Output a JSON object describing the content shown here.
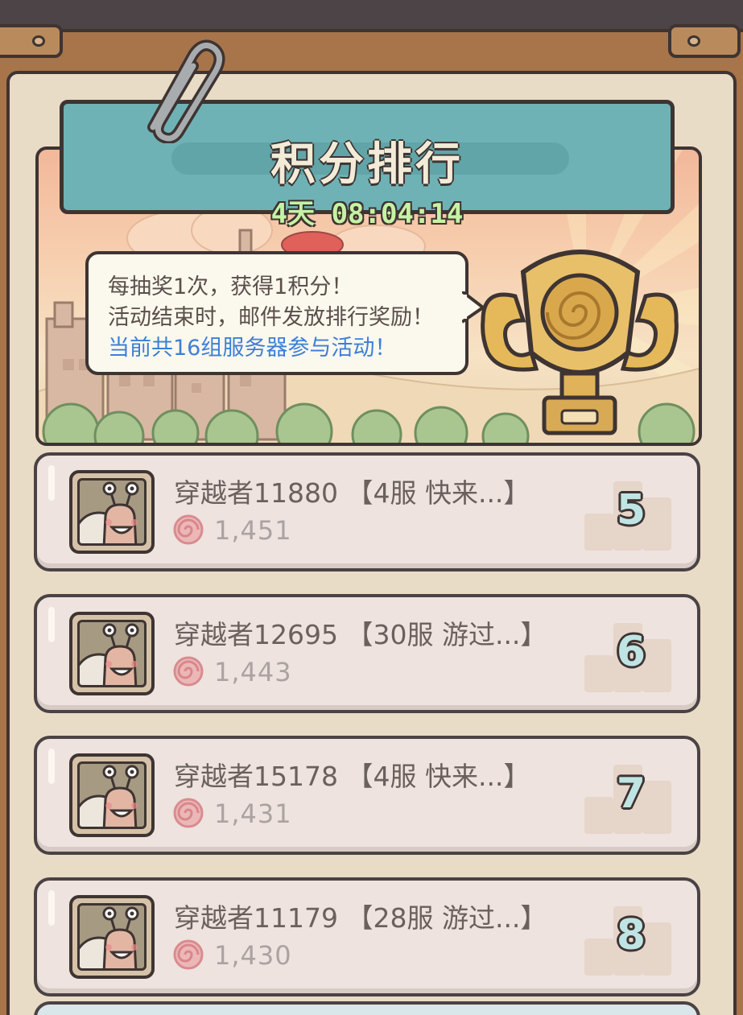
{
  "header": {
    "title": "积分排行",
    "countdown": "4天 08:04:14"
  },
  "info_bubble": {
    "line1": "每抽奖1次，获得1积分！",
    "line2": "活动结束时，邮件发放排行奖励！",
    "line3": "当前共16组服务器参与活动！"
  },
  "colors": {
    "title_plate": "#6fb2b6",
    "timer_text": "#c6f2a4",
    "highlight_text": "#3d7fd6",
    "row_bg": "#eee3de",
    "rank_number": "#bfe4e4"
  },
  "icons": {
    "score": "snail-shell-icon",
    "avatar": "snail-avatar-icon",
    "trophy": "trophy-icon",
    "clip": "paper-clip-icon"
  },
  "leaderboard": [
    {
      "rank": "5",
      "name": "穿越者11880 【4服  快来...】",
      "score": "1,451"
    },
    {
      "rank": "6",
      "name": "穿越者12695 【30服  游过...】",
      "score": "1,443"
    },
    {
      "rank": "7",
      "name": "穿越者15178 【4服  快来...】",
      "score": "1,431"
    },
    {
      "rank": "8",
      "name": "穿越者11179 【28服  游过...】",
      "score": "1,430"
    }
  ]
}
